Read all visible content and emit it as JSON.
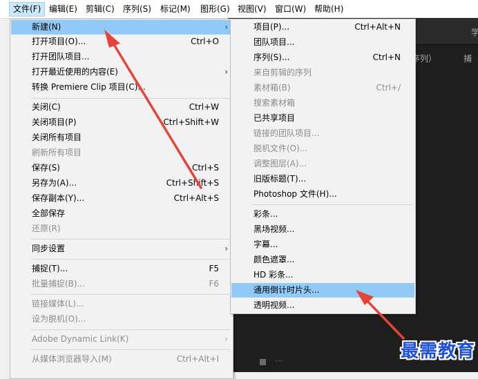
{
  "menubar": {
    "items": [
      {
        "label": "文件(F)"
      },
      {
        "label": "编辑(E)"
      },
      {
        "label": "剪辑(C)"
      },
      {
        "label": "序列(S)"
      },
      {
        "label": "标记(M)"
      },
      {
        "label": "图形(G)"
      },
      {
        "label": "视图(V)"
      },
      {
        "label": "窗口(W)"
      },
      {
        "label": "帮助(H)"
      }
    ]
  },
  "background": {
    "panel_title": "学",
    "seq_tab": "序列）",
    "capture": "捕"
  },
  "file_menu": {
    "items": [
      {
        "label": "新建(N)",
        "arrow": "›"
      },
      {
        "label": "打开项目(O)...",
        "shortcut": "Ctrl+O"
      },
      {
        "label": "打开团队项目..."
      },
      {
        "label": "打开最近使用的内容(E)",
        "arrow": "›"
      },
      {
        "label": "转换 Premiere Clip 项目(C)..."
      },
      {
        "label": "关闭(C)",
        "shortcut": "Ctrl+W"
      },
      {
        "label": "关闭项目(P)",
        "shortcut": "Ctrl+Shift+W"
      },
      {
        "label": "关闭所有项目"
      },
      {
        "label": "刷新所有项目"
      },
      {
        "label": "保存(S)",
        "shortcut": "Ctrl+S"
      },
      {
        "label": "另存为(A)...",
        "shortcut": "Ctrl+Shift+S"
      },
      {
        "label": "保存副本(Y)...",
        "shortcut": "Ctrl+Alt+S"
      },
      {
        "label": "全部保存"
      },
      {
        "label": "还原(R)"
      },
      {
        "label": "同步设置",
        "arrow": "›"
      },
      {
        "label": "捕捉(T)...",
        "shortcut": "F5"
      },
      {
        "label": "批量捕捉(B)...",
        "shortcut": "F6"
      },
      {
        "label": "链接媒体(L)..."
      },
      {
        "label": "设为脱机(O)..."
      },
      {
        "label": "Adobe Dynamic Link(K)",
        "arrow": "›"
      },
      {
        "label": "从媒体浏览器导入(M)",
        "shortcut": "Ctrl+Alt+I"
      }
    ]
  },
  "new_submenu": {
    "items": [
      {
        "label": "项目(P)...",
        "shortcut": "Ctrl+Alt+N"
      },
      {
        "label": "团队项目..."
      },
      {
        "label": "序列(S)...",
        "shortcut": "Ctrl+N"
      },
      {
        "label": "来自剪辑的序列"
      },
      {
        "label": "素材箱(B)",
        "shortcut": "Ctrl+/"
      },
      {
        "label": "搜索素材箱"
      },
      {
        "label": "已共享项目"
      },
      {
        "label": "链接的团队项目..."
      },
      {
        "label": "脱机文件(O)..."
      },
      {
        "label": "调整图层(A)..."
      },
      {
        "label": "旧版标题(T)..."
      },
      {
        "label": "Photoshop 文件(H)..."
      },
      {
        "label": "彩条..."
      },
      {
        "label": "黑场视频..."
      },
      {
        "label": "字幕..."
      },
      {
        "label": "颜色遮罩..."
      },
      {
        "label": "HD 彩条..."
      },
      {
        "label": "通用倒计时片头..."
      },
      {
        "label": "透明视频..."
      }
    ]
  },
  "watermark": "最需教育",
  "colors": {
    "highlight": "#91c9f7",
    "arrow": "#e8423a",
    "watermark": "#1f50d9"
  }
}
